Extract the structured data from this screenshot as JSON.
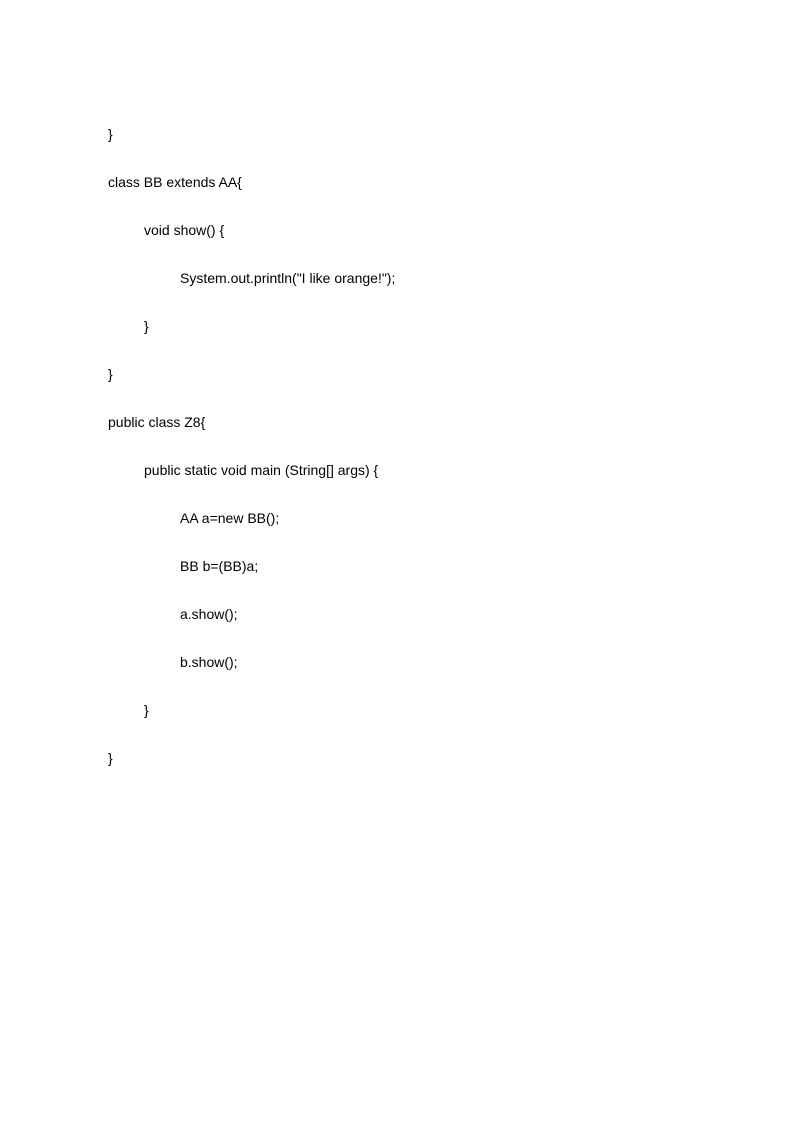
{
  "code": {
    "line1": "}",
    "line2": "class BB extends AA{",
    "line3": "void show() {",
    "line4": "System.out.println(\"I like orange!\");",
    "line5": "}",
    "line6": "}",
    "line7": "public class Z8{",
    "line8": "public static void main (String[] args) {",
    "line9": "AA a=new BB();",
    "line10": "BB b=(BB)a;",
    "line11": "a.show();",
    "line12": "b.show();",
    "line13": "}",
    "line14": "}"
  }
}
